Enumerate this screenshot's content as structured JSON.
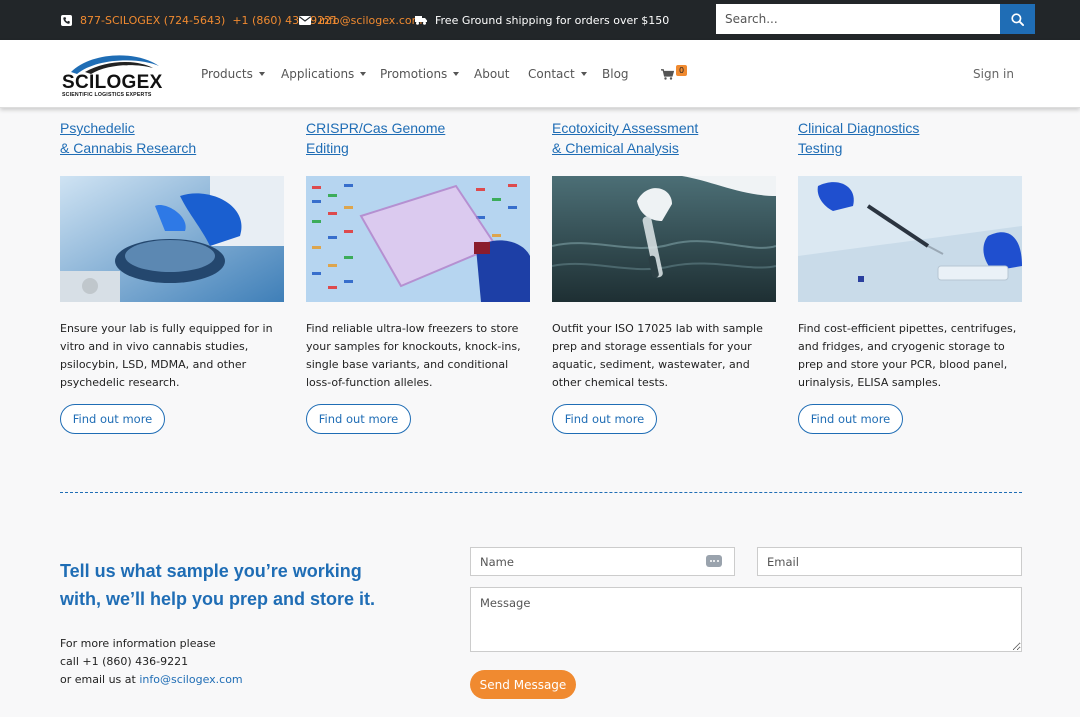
{
  "topbar": {
    "phone_tollfree": "877-SCILOGEX (724-5643)",
    "phone_local": "+1 (860) 436-9221",
    "email": "info@scilogex.com",
    "shipping": "Free Ground shipping for orders over $150",
    "search_placeholder": "Search..."
  },
  "brand": {
    "name": "SCILOGEX",
    "tagline": "SCIENTIFIC LOGISTICS EXPERTS"
  },
  "nav": {
    "products": "Products",
    "applications": "Applications",
    "promotions": "Promotions",
    "about": "About",
    "contact": "Contact",
    "blog": "Blog",
    "cart_count": "0",
    "signin": "Sign in"
  },
  "cards": [
    {
      "title": "Psychedelic\n& Cannabis Research",
      "description": "Ensure your lab is fully equipped for in vitro and in vivo cannabis studies, psilocybin, LSD, MDMA, and other psychedelic research.",
      "button": "Find out more"
    },
    {
      "title": "CRISPR/Cas Genome\nEditing",
      "description": "Find reliable ultra-low freezers to store your samples for knockouts, knock-ins, single base variants, and conditional loss-of-function alleles.",
      "button": "Find out more"
    },
    {
      "title": "Ecotoxicity Assessment\n& Chemical Analysis",
      "description": "Outfit your ISO 17025 lab with sample prep and storage essentials for your aquatic, sediment, wastewater, and other chemical tests.",
      "button": "Find out more"
    },
    {
      "title": "Clinical Diagnostics\nTesting",
      "description": "Find cost-efficient pipettes, centrifuges, and fridges, and cryogenic storage to prep and store your PCR, blood panel, urinalysis, ELISA samples.",
      "button": "Find out more"
    }
  ],
  "contact": {
    "heading": "Tell us what sample you’re working with, we’ll help you prep and store it.",
    "info_line1": "For more information please",
    "info_line2": "call +1 (860) 436-9221",
    "info_line3_prefix": "or email us at",
    "info_email": "info@scilogex.com",
    "name_placeholder": "Name",
    "email_placeholder": "Email",
    "message_placeholder": "Message",
    "send_label": "Send Message"
  },
  "colors": {
    "accent_blue": "#1f6db5",
    "accent_orange": "#f08a30",
    "topbar_bg": "#222629"
  }
}
